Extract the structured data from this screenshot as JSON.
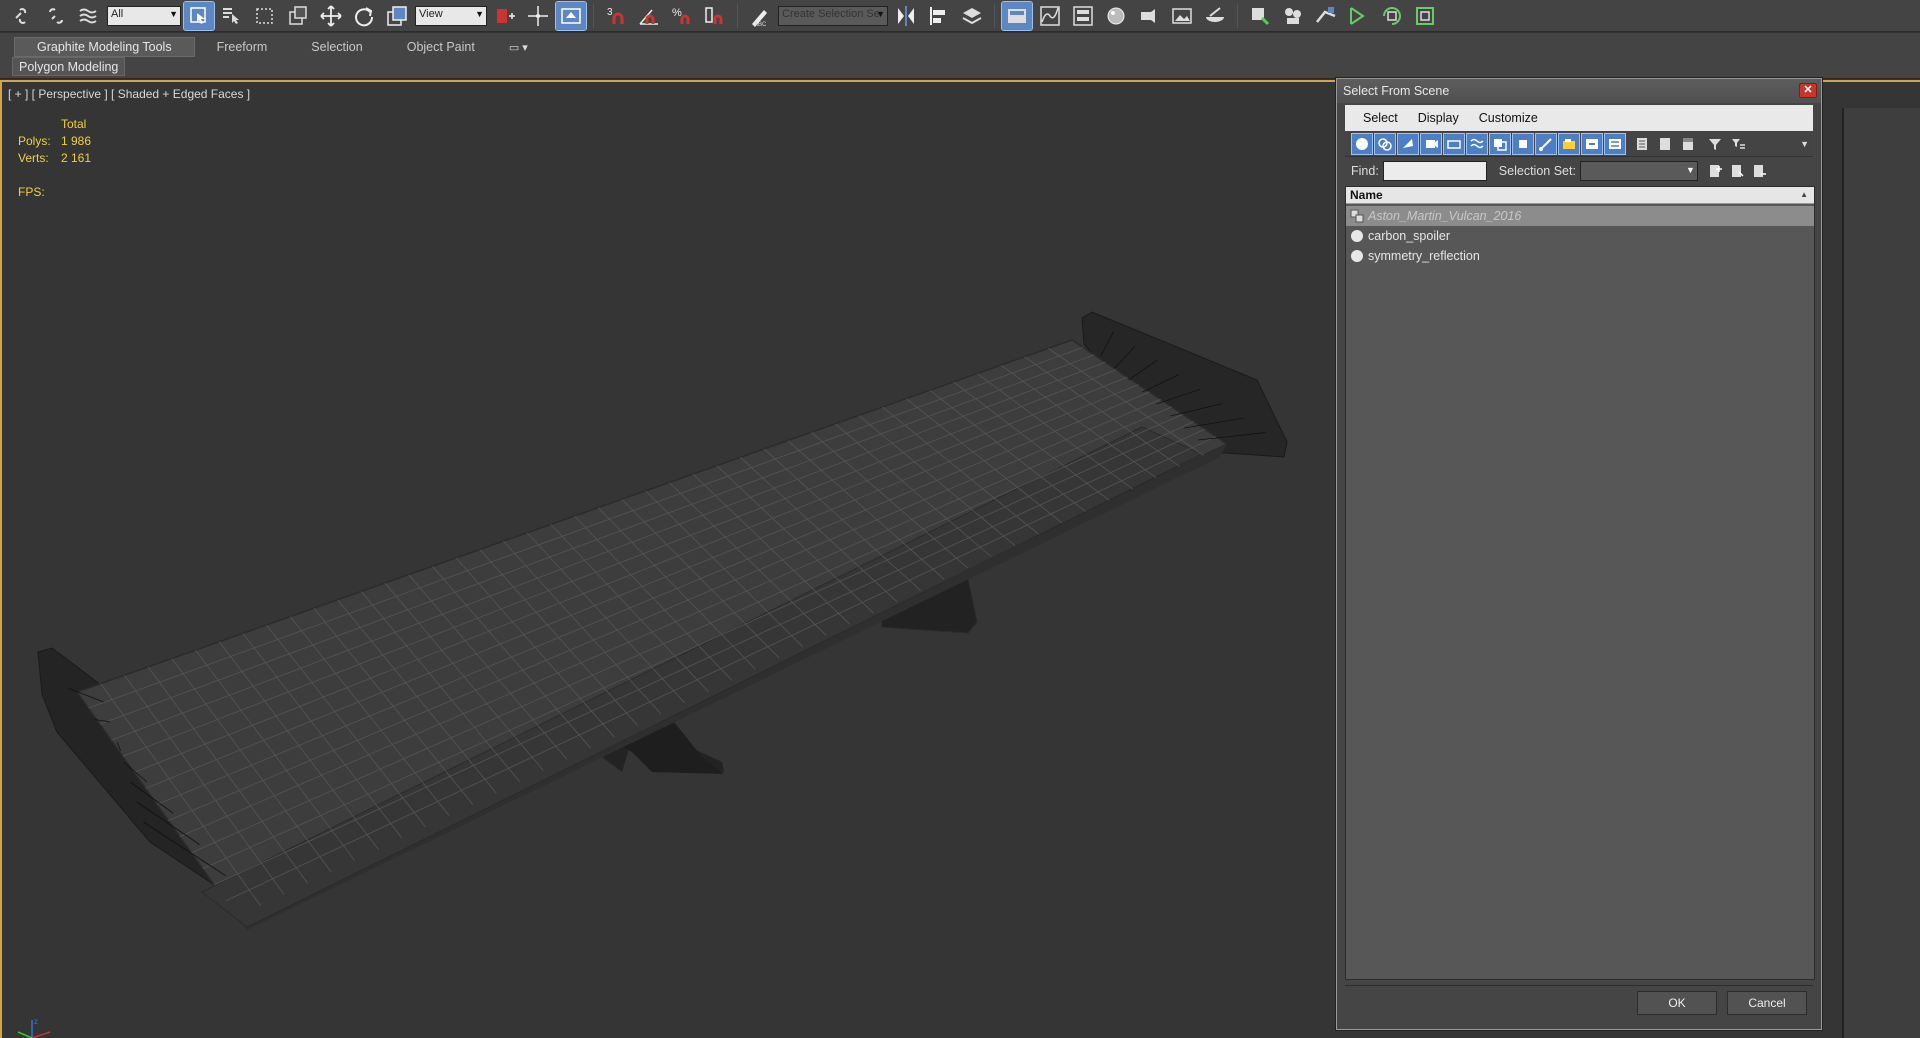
{
  "toolbar": {
    "filter_value": "All",
    "refcoord_value": "View",
    "selection_set_placeholder": "Create Selection Se",
    "icons": [
      "link-icon",
      "unlink-icon",
      "bind-space-warp-icon",
      "select-object-icon",
      "select-by-name-icon",
      "rect-region-icon",
      "window-crossing-icon",
      "move-icon",
      "rotate-icon",
      "scale-icon",
      "pivot-icon",
      "manipulate-icon",
      "snap-3d-icon",
      "angle-snap-icon",
      "percent-snap-icon",
      "spinner-snap-icon",
      "edit-named-selection-icon",
      "mirror-icon",
      "align-icon",
      "layer-manager-icon",
      "graphite-toggle-icon",
      "curve-editor-icon",
      "schematic-view-icon",
      "material-editor-icon",
      "render-setup-icon",
      "rendered-frame-icon",
      "render-icon"
    ],
    "accent_color": "#5d87c2"
  },
  "ribbon": {
    "tabs": [
      "Graphite Modeling Tools",
      "Freeform",
      "Selection",
      "Object Paint"
    ],
    "active_tab": "Graphite Modeling Tools",
    "panel_label": "Polygon Modeling"
  },
  "viewport": {
    "label": "[ + ] [ Perspective ] [ Shaded + Edged Faces ]",
    "stats": {
      "total_label": "Total",
      "polys_label": "Polys:",
      "polys_value": "1 986",
      "verts_label": "Verts:",
      "verts_value": "2 161",
      "fps_label": "FPS:"
    },
    "border_color": "#d2a54a"
  },
  "dialog": {
    "title": "Select From Scene",
    "menu": [
      "Select",
      "Display",
      "Customize"
    ],
    "find_label": "Find:",
    "find_value": "",
    "selection_set_label": "Selection Set:",
    "column_header": "Name",
    "items": [
      {
        "name": "Aston_Martin_Vulcan_2016",
        "icon": "group-icon",
        "selected": true
      },
      {
        "name": "carbon_spoiler",
        "icon": "geometry-icon",
        "selected": false
      },
      {
        "name": "symmetry_reflection",
        "icon": "geometry-icon",
        "selected": false
      }
    ],
    "ok_label": "OK",
    "cancel_label": "Cancel"
  }
}
